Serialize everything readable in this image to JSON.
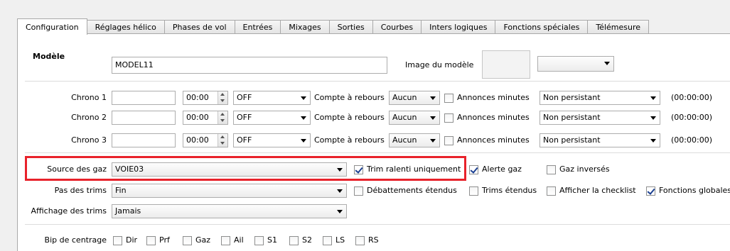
{
  "tabs": [
    {
      "label": "Configuration",
      "active": true
    },
    {
      "label": "Réglages hélico"
    },
    {
      "label": "Phases de vol"
    },
    {
      "label": "Entrées"
    },
    {
      "label": "Mixages"
    },
    {
      "label": "Sorties"
    },
    {
      "label": "Courbes"
    },
    {
      "label": "Inters logiques"
    },
    {
      "label": "Fonctions spéciales"
    },
    {
      "label": "Télémesure"
    }
  ],
  "model": {
    "label": "Modèle",
    "name": "MODEL11",
    "image_label": "Image du modèle",
    "image_select": ""
  },
  "timers": [
    {
      "label": "Chrono 1",
      "name": "",
      "time": "00:00",
      "mode": "OFF",
      "countdown_label": "Compte à rebours",
      "countdown": "Aucun",
      "minute_label": "Annonces minutes",
      "persistent": "Non persistant",
      "value": "(00:00:00)"
    },
    {
      "label": "Chrono 2",
      "name": "",
      "time": "00:00",
      "mode": "OFF",
      "countdown_label": "Compte à rebours",
      "countdown": "Aucun",
      "minute_label": "Annonces minutes",
      "persistent": "Non persistant",
      "value": "(00:00:00)"
    },
    {
      "label": "Chrono 3",
      "name": "",
      "time": "00:00",
      "mode": "OFF",
      "countdown_label": "Compte à rebours",
      "countdown": "Aucun",
      "minute_label": "Annonces minutes",
      "persistent": "Non persistant",
      "value": "(00:00:00)"
    }
  ],
  "throttle": {
    "label": "Source des gaz",
    "source": "VOIE03",
    "idle_trim_label": "Trim ralenti uniquement",
    "idle_trim_checked": true,
    "warning_label": "Alerte gaz",
    "warning_checked": true,
    "reversed_label": "Gaz inversés",
    "reversed_checked": false
  },
  "trims": {
    "step_label": "Pas des trims",
    "step": "Fin",
    "ext_limits_label": "Débattements étendus",
    "ext_trims_label": "Trims étendus",
    "checklist_label": "Afficher la checklist",
    "global_funcs_label": "Fonctions globales",
    "global_funcs_checked": true,
    "display_label": "Affichage des trims",
    "display": "Jamais"
  },
  "beep": {
    "label": "Bip de centrage",
    "items": [
      "Dir",
      "Prf",
      "Gaz",
      "Ail",
      "S1",
      "S2",
      "LS",
      "RS"
    ]
  },
  "colors": {
    "highlight": "#e8222b",
    "check": "#1a3f91"
  }
}
